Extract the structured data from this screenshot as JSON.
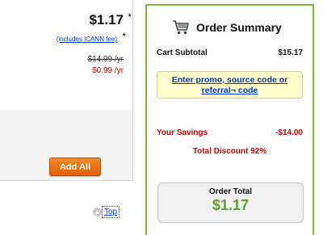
{
  "domain_card": {
    "price": "$1.17",
    "price_star": "*",
    "fee_link": "(includes ICANN fee)",
    "fee_star": "*",
    "old_price": "$14.99 /yr",
    "new_price": "$0.99 /yr"
  },
  "actions": {
    "add_all_label": "Add All",
    "top_link": "Top"
  },
  "summary": {
    "title": "Order Summary",
    "cart_subtotal_label": "Cart Subtotal",
    "cart_subtotal_value": "$15.17",
    "promo_text": "Enter promo, source code or referral¬ code",
    "savings_label": "Your Savings",
    "savings_value": "-$14.00",
    "total_discount": "Total Discount 92%",
    "order_total_label": "Order Total",
    "order_total_value": "$1.17"
  },
  "colors": {
    "accent_green": "#7bb63c",
    "price_green": "#5aa02c",
    "alert_red": "#cc0000",
    "link_blue": "#0033cc",
    "button_orange": "#f07a1a"
  },
  "icons": {
    "cart": "cart-icon",
    "top_arrow": "up-arrow-icon"
  }
}
